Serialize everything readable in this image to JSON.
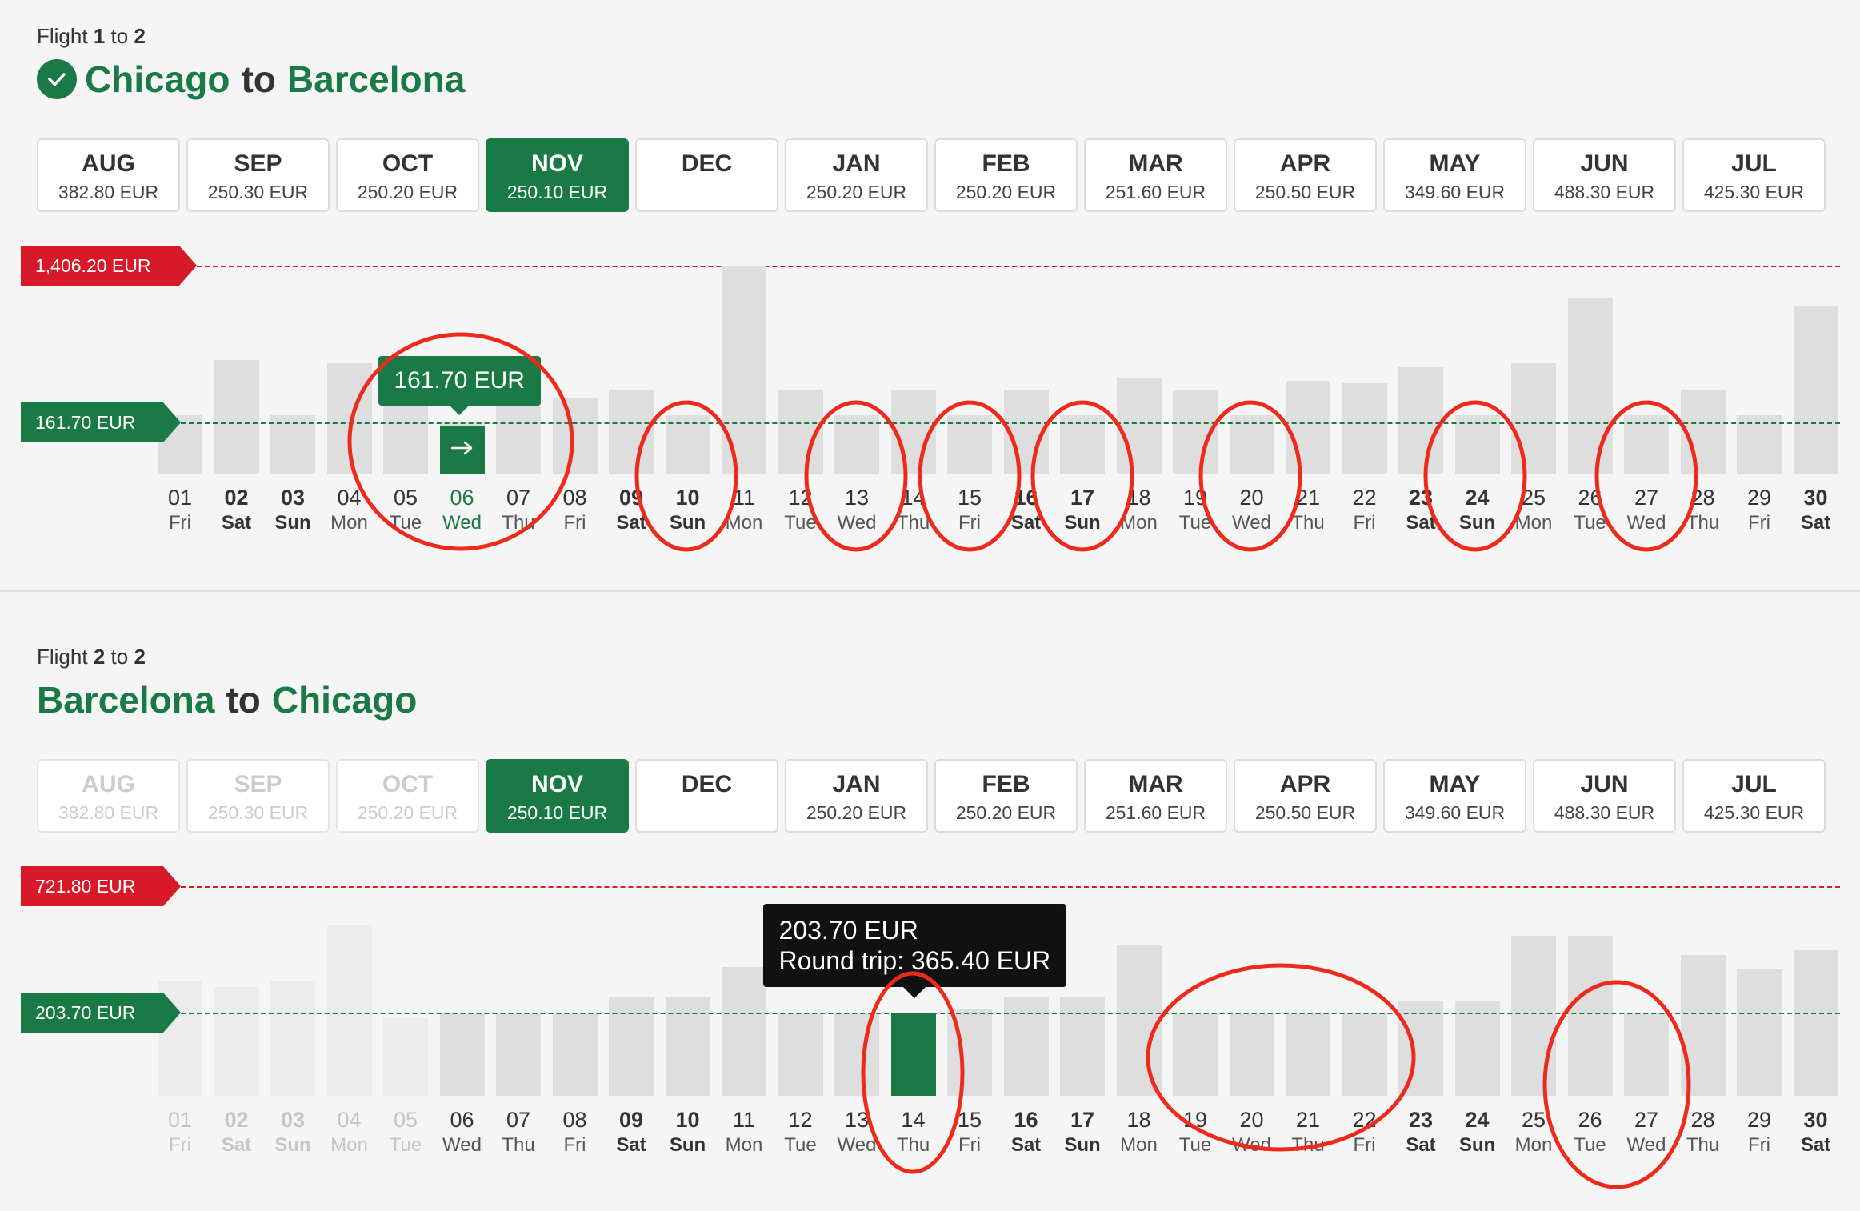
{
  "flight1": {
    "label_prefix": "Flight",
    "label_num": "1",
    "label_mid": "to",
    "label_total": "2",
    "origin": "Chicago",
    "to_word": "to",
    "destination": "Barcelona",
    "check_icon": "check-circle-icon",
    "months": [
      {
        "name": "AUG",
        "price": "382.80 EUR",
        "state": "normal"
      },
      {
        "name": "SEP",
        "price": "250.30 EUR",
        "state": "normal"
      },
      {
        "name": "OCT",
        "price": "250.20 EUR",
        "state": "normal"
      },
      {
        "name": "NOV",
        "price": "250.10 EUR",
        "state": "active"
      },
      {
        "name": "DEC",
        "price": "",
        "state": "normal"
      },
      {
        "name": "JAN",
        "price": "250.20 EUR",
        "state": "normal"
      },
      {
        "name": "FEB",
        "price": "250.20 EUR",
        "state": "normal"
      },
      {
        "name": "MAR",
        "price": "251.60 EUR",
        "state": "normal"
      },
      {
        "name": "APR",
        "price": "250.50 EUR",
        "state": "normal"
      },
      {
        "name": "MAY",
        "price": "349.60 EUR",
        "state": "normal"
      },
      {
        "name": "JUN",
        "price": "488.30 EUR",
        "state": "normal"
      },
      {
        "name": "JUL",
        "price": "425.30 EUR",
        "state": "normal"
      }
    ],
    "max_label": "1,406.20 EUR",
    "min_label": "161.70 EUR",
    "max_value": 1406.2,
    "min_value": 161.7,
    "selected_price": "161.70 EUR",
    "selected_index": 5
  },
  "flight2": {
    "label_prefix": "Flight",
    "label_num": "2",
    "label_mid": "to",
    "label_total": "2",
    "origin": "Barcelona",
    "to_word": "to",
    "destination": "Chicago",
    "months": [
      {
        "name": "AUG",
        "price": "382.80 EUR",
        "state": "disabled"
      },
      {
        "name": "SEP",
        "price": "250.30 EUR",
        "state": "disabled"
      },
      {
        "name": "OCT",
        "price": "250.20 EUR",
        "state": "disabled"
      },
      {
        "name": "NOV",
        "price": "250.10 EUR",
        "state": "active"
      },
      {
        "name": "DEC",
        "price": "",
        "state": "normal"
      },
      {
        "name": "JAN",
        "price": "250.20 EUR",
        "state": "normal"
      },
      {
        "name": "FEB",
        "price": "250.20 EUR",
        "state": "normal"
      },
      {
        "name": "MAR",
        "price": "251.60 EUR",
        "state": "normal"
      },
      {
        "name": "APR",
        "price": "250.50 EUR",
        "state": "normal"
      },
      {
        "name": "MAY",
        "price": "349.60 EUR",
        "state": "normal"
      },
      {
        "name": "JUN",
        "price": "488.30 EUR",
        "state": "normal"
      },
      {
        "name": "JUL",
        "price": "425.30 EUR",
        "state": "normal"
      }
    ],
    "max_label": "721.80 EUR",
    "min_label": "203.70 EUR",
    "max_value": 721.8,
    "min_value": 203.7,
    "tooltip_price": "203.70 EUR",
    "tooltip_round": "Round trip: 365.40 EUR",
    "selected_index": 13
  },
  "days": [
    {
      "num": "01",
      "name": "Fri",
      "wk": false
    },
    {
      "num": "02",
      "name": "Sat",
      "wk": true
    },
    {
      "num": "03",
      "name": "Sun",
      "wk": true
    },
    {
      "num": "04",
      "name": "Mon",
      "wk": false
    },
    {
      "num": "05",
      "name": "Tue",
      "wk": false
    },
    {
      "num": "06",
      "name": "Wed",
      "wk": false
    },
    {
      "num": "07",
      "name": "Thu",
      "wk": false
    },
    {
      "num": "08",
      "name": "Fri",
      "wk": false
    },
    {
      "num": "09",
      "name": "Sat",
      "wk": true
    },
    {
      "num": "10",
      "name": "Sun",
      "wk": true
    },
    {
      "num": "11",
      "name": "Mon",
      "wk": false
    },
    {
      "num": "12",
      "name": "Tue",
      "wk": false
    },
    {
      "num": "13",
      "name": "Wed",
      "wk": false
    },
    {
      "num": "14",
      "name": "Thu",
      "wk": false
    },
    {
      "num": "15",
      "name": "Fri",
      "wk": false
    },
    {
      "num": "16",
      "name": "Sat",
      "wk": true
    },
    {
      "num": "17",
      "name": "Sun",
      "wk": true
    },
    {
      "num": "18",
      "name": "Mon",
      "wk": false
    },
    {
      "num": "19",
      "name": "Tue",
      "wk": false
    },
    {
      "num": "20",
      "name": "Wed",
      "wk": false
    },
    {
      "num": "21",
      "name": "Thu",
      "wk": false
    },
    {
      "num": "22",
      "name": "Fri",
      "wk": false
    },
    {
      "num": "23",
      "name": "Sat",
      "wk": true
    },
    {
      "num": "24",
      "name": "Sun",
      "wk": true
    },
    {
      "num": "25",
      "name": "Mon",
      "wk": false
    },
    {
      "num": "26",
      "name": "Tue",
      "wk": false
    },
    {
      "num": "27",
      "name": "Wed",
      "wk": false
    },
    {
      "num": "28",
      "name": "Thu",
      "wk": false
    },
    {
      "num": "29",
      "name": "Fri",
      "wk": false
    },
    {
      "num": "30",
      "name": "Sat",
      "wk": true
    }
  ],
  "chart_data": [
    {
      "type": "bar",
      "categories": [
        "01",
        "02",
        "03",
        "04",
        "05",
        "06",
        "07",
        "08",
        "09",
        "10",
        "11",
        "12",
        "13",
        "14",
        "15",
        "16",
        "17",
        "18",
        "19",
        "20",
        "21",
        "22",
        "23",
        "24",
        "25",
        "26",
        "27",
        "28",
        "29",
        "30"
      ],
      "values": [
        220,
        660,
        220,
        630,
        420,
        161.7,
        560,
        350,
        420,
        220,
        1406.2,
        420,
        220,
        420,
        220,
        420,
        220,
        510,
        420,
        220,
        490,
        470,
        600,
        220,
        630,
        1150,
        220,
        420,
        220,
        1090
      ],
      "ylim": [
        0,
        1406.2
      ]
    },
    {
      "type": "bar",
      "categories": [
        "01",
        "02",
        "03",
        "04",
        "05",
        "06",
        "07",
        "08",
        "09",
        "10",
        "11",
        "12",
        "13",
        "14",
        "15",
        "16",
        "17",
        "18",
        "19",
        "20",
        "21",
        "22",
        "23",
        "24",
        "25",
        "26",
        "27",
        "28",
        "29",
        "30"
      ],
      "values": [
        330,
        310,
        330,
        560,
        180,
        200,
        200,
        200,
        270,
        270,
        390,
        200,
        200,
        203.7,
        220,
        270,
        270,
        480,
        200,
        200,
        200,
        200,
        250,
        250,
        520,
        520,
        200,
        440,
        380,
        460
      ],
      "ylim": [
        0,
        721.8
      ]
    }
  ]
}
